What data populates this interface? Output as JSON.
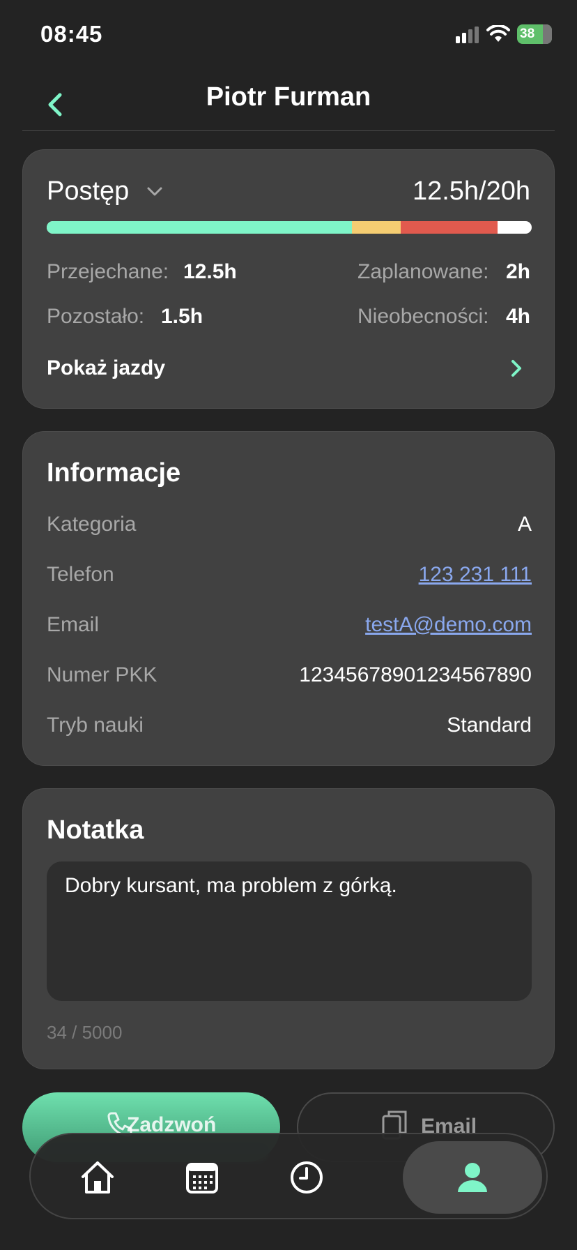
{
  "status_bar": {
    "time": "08:45",
    "battery": "38"
  },
  "header": {
    "title": "Piotr Furman"
  },
  "progress": {
    "title": "Postęp",
    "total": "12.5h/20h",
    "bar": {
      "driven_fraction": 0.63,
      "planned_fraction": 0.1,
      "absence_fraction": 0.2
    },
    "driven_label": "Przejechane:",
    "driven_value": "12.5h",
    "planned_label": "Zaplanowane:",
    "planned_value": "2h",
    "remaining_label": "Pozostało:",
    "remaining_value": "1.5h",
    "absences_label": "Nieobecności:",
    "absences_value": "4h",
    "show_rides": "Pokaż jazdy"
  },
  "info": {
    "heading": "Informacje",
    "rows": [
      {
        "label": "Kategoria",
        "value": "A"
      },
      {
        "label": "Telefon",
        "value": "123 231 111"
      },
      {
        "label": "Email",
        "value": "testA@demo.com"
      },
      {
        "label": "Numer PKK",
        "value": "12345678901234567890"
      },
      {
        "label": "Tryb nauki",
        "value": "Standard"
      }
    ]
  },
  "note": {
    "heading": "Notatka",
    "text": "Dobry kursant, ma problem z górką.",
    "counter": "34 / 5000"
  },
  "actions": {
    "call_label": "Zadzwoń",
    "email_label": "Email"
  },
  "tabs": [
    {
      "icon": "home-icon",
      "active": false
    },
    {
      "icon": "calendar-icon",
      "active": false
    },
    {
      "icon": "clock-icon",
      "active": false
    },
    {
      "icon": "person-icon",
      "active": true
    }
  ],
  "colors": {
    "accent": "#7ff5c8",
    "planned": "#f5cd72",
    "absence": "#e15a4e",
    "link": "#8aa8ee"
  }
}
